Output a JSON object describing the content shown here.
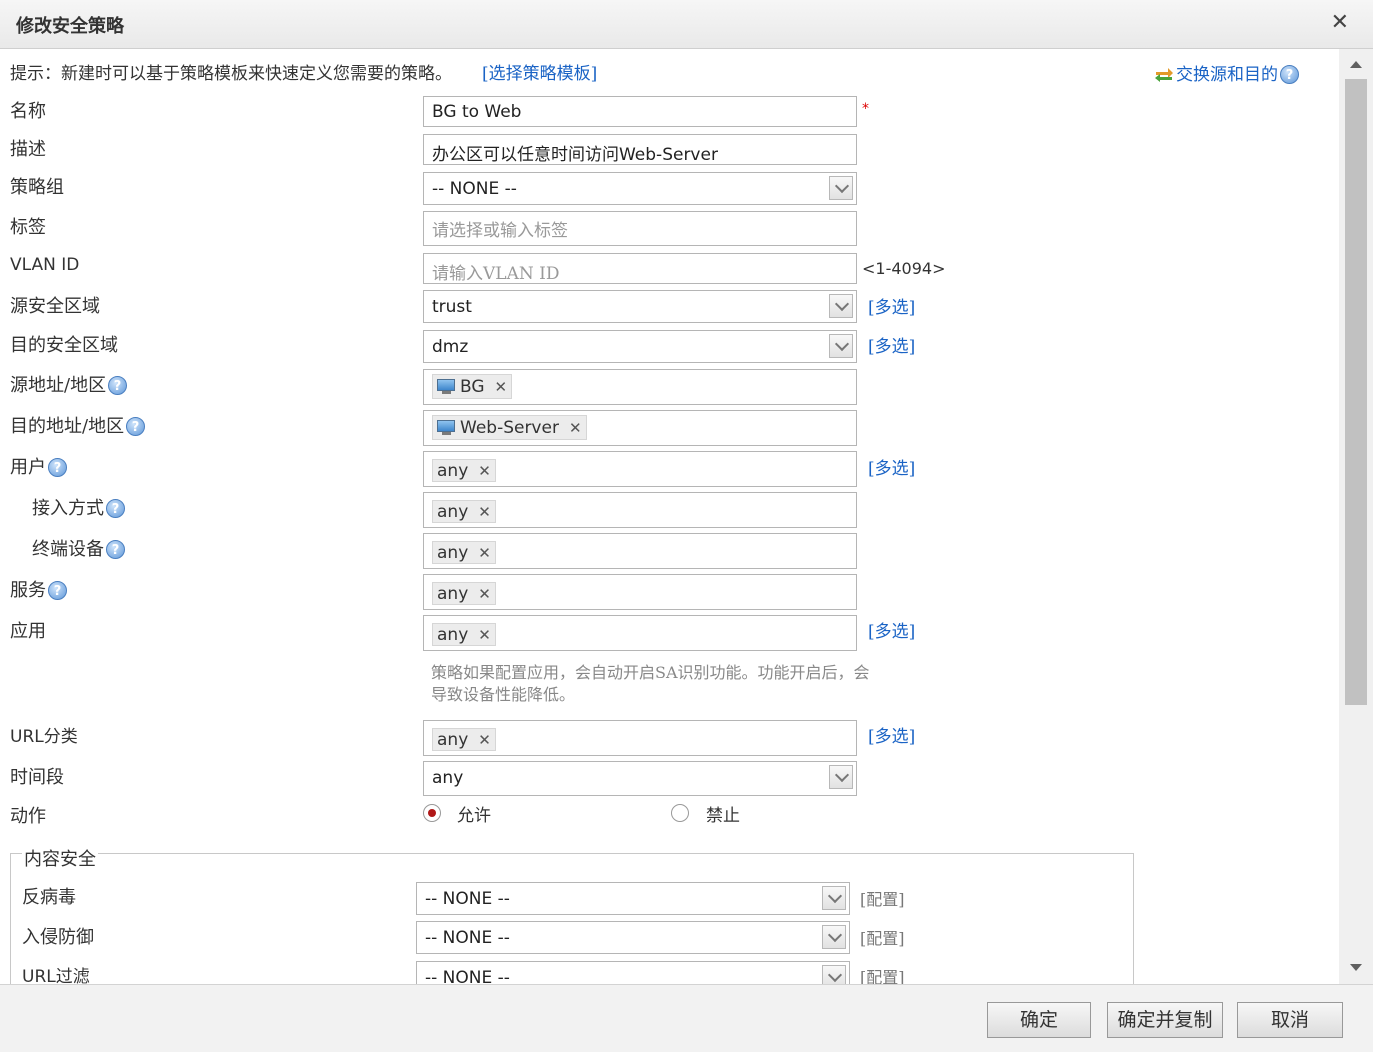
{
  "dialog": {
    "title": "修改安全策略"
  },
  "tip": {
    "text": "提示：新建时可以基于策略模板来快速定义您需要的策略。",
    "link": "[选择策略模板]",
    "swap": "交换源和目的"
  },
  "form": {
    "name": {
      "label": "名称",
      "value": "BG to Web",
      "required": "*"
    },
    "desc": {
      "label": "描述",
      "value": "办公区可以任意时间访问Web-Server"
    },
    "group": {
      "label": "策略组",
      "value": "-- NONE --"
    },
    "tag": {
      "label": "标签",
      "placeholder": "请选择或输入标签"
    },
    "vlan": {
      "label": "VLAN ID",
      "placeholder": "请输入VLAN ID",
      "range": "<1-4094>"
    },
    "src_zone": {
      "label": "源安全区域",
      "value": "trust",
      "multi": "[多选]"
    },
    "dst_zone": {
      "label": "目的安全区域",
      "value": "dmz",
      "multi": "[多选]"
    },
    "src_addr": {
      "label": "源地址/地区",
      "tag": "BG"
    },
    "dst_addr": {
      "label": "目的地址/地区",
      "tag": "Web-Server"
    },
    "user": {
      "label": "用户",
      "tag": "any",
      "multi": "[多选]"
    },
    "access": {
      "label": "接入方式",
      "tag": "any"
    },
    "device": {
      "label": "终端设备",
      "tag": "any"
    },
    "service": {
      "label": "服务",
      "tag": "any"
    },
    "app": {
      "label": "应用",
      "tag": "any",
      "multi": "[多选]",
      "hint": "策略如果配置应用，会自动开启SA识别功能。功能开启后，会导致设备性能降低。"
    },
    "url_cat": {
      "label": "URL分类",
      "tag": "any",
      "multi": "[多选]"
    },
    "time": {
      "label": "时间段",
      "value": "any"
    },
    "action": {
      "label": "动作",
      "allow": "允许",
      "deny": "禁止",
      "selected": "允许"
    }
  },
  "content_security": {
    "legend": "内容安全",
    "antivirus": {
      "label": "反病毒",
      "value": "-- NONE --",
      "cfg": "[配置]"
    },
    "ips": {
      "label": "入侵防御",
      "value": "-- NONE --",
      "cfg": "[配置]"
    },
    "url_filter": {
      "label": "URL过滤",
      "value": "-- NONE --",
      "cfg": "[配置]"
    }
  },
  "footer": {
    "ok": "确定",
    "ok_copy": "确定并复制",
    "cancel": "取消"
  },
  "icons": {
    "close": "close-icon",
    "help": "help-icon",
    "swap": "swap-icon",
    "pc": "computer-icon",
    "dropdown": "chevron-down-icon"
  },
  "colors": {
    "link": "#1a63c5",
    "required": "#dd0000",
    "radio_selected": "#b01818"
  }
}
